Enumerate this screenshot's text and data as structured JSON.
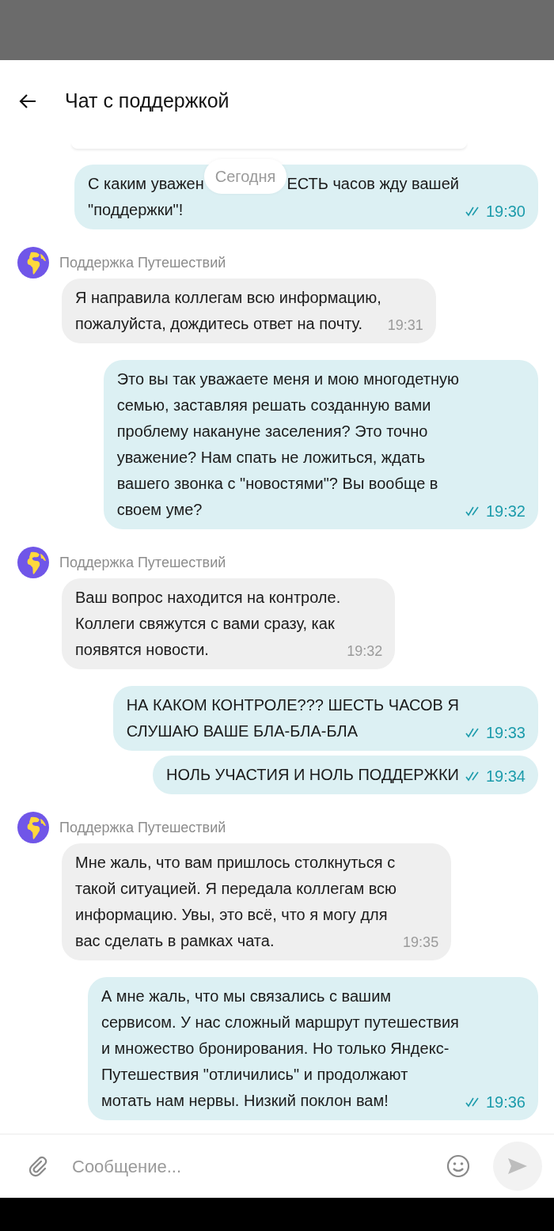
{
  "header": {
    "title": "Чат с поддержкой"
  },
  "messages": [
    {
      "kind": "outgoing",
      "text_before_separator": "С каким уважен",
      "date_separator": "Сегодня",
      "text_after_separator": "ЕСТЬ часов жду вашей",
      "text": "\"поддержки\"!",
      "time": "19:30",
      "read": true
    },
    {
      "kind": "incoming",
      "sender": "Поддержка Путешествий",
      "text": "Я направила коллегам всю информацию,\nпожалуйста, дождитесь ответ на почту.",
      "time": "19:31"
    },
    {
      "kind": "outgoing",
      "text": "Это вы так уважаете меня и мою многодетную\nсемью, заставляя решать созданную вами\nпроблему накануне заселения? Это точно\nуважение? Нам спать не ложиться, ждать\nвашего звонка с \"новостями\"? Вы вообще в\nсвоем уме?",
      "time": "19:32",
      "read": true
    },
    {
      "kind": "incoming",
      "sender": "Поддержка Путешествий",
      "text": "Ваш вопрос находится на контроле.\nКоллеги свяжутся с вами сразу, как\nпоявятся новости.",
      "time": "19:32"
    },
    {
      "kind": "outgoing",
      "text": "НА КАКОМ КОНТРОЛЕ??? ШЕСТЬ ЧАСОВ Я\nСЛУШАЮ ВАШЕ БЛА-БЛА-БЛА",
      "time": "19:33",
      "read": true
    },
    {
      "kind": "outgoing",
      "text": "НОЛЬ УЧАСТИЯ И НОЛЬ ПОДДЕРЖКИ",
      "time": "19:34",
      "read": true
    },
    {
      "kind": "incoming",
      "sender": "Поддержка Путешествий",
      "text": "Мне жаль, что вам пришлось столкнуться с\nтакой ситуацией. Я передала коллегам всю\nинформацию. Увы, это всё, что я могу для\nвас сделать в рамках чата.",
      "time": "19:35"
    },
    {
      "kind": "outgoing",
      "text": "А мне жаль, что мы связались с вашим\nсервисом. У нас сложный маршрут путешествия\nи множество бронирования. Но только Яндекс-\nПутешествия \"отличились\" и продолжают\nмотать нам нервы. Низкий поклон вам!",
      "time": "19:36",
      "read": true
    }
  ],
  "composer": {
    "placeholder": "Сообщение..."
  }
}
